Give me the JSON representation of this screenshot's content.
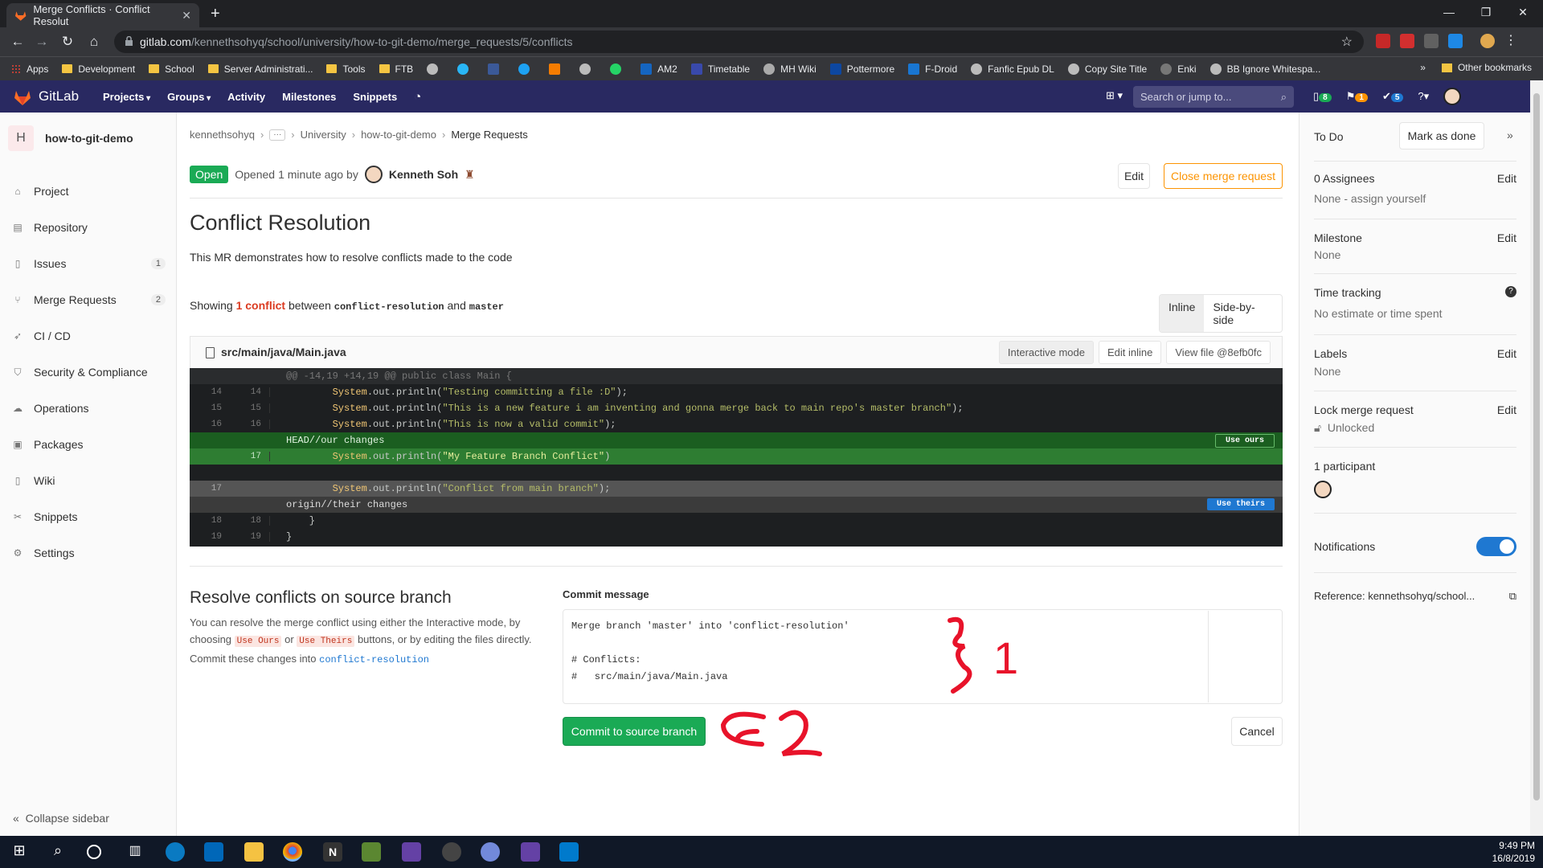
{
  "browser": {
    "tab_title": "Merge Conflicts · Conflict Resolut",
    "url_host": "gitlab.com",
    "url_path": "/kennethsohyq/school/university/how-to-git-demo/merge_requests/5/conflicts",
    "bookmarks": [
      "Apps",
      "Development",
      "School",
      "Server Administrati...",
      "Tools",
      "FTB",
      "",
      "",
      "",
      "",
      "",
      "",
      "",
      "AM2",
      "Timetable",
      "MH Wiki",
      "Pottermore",
      "F-Droid",
      "Fanfic Epub DL",
      "Copy Site Title",
      "Enki",
      "BB Ignore Whitespa..."
    ],
    "other_bookmarks": "Other bookmarks"
  },
  "gitlab": {
    "brand": "GitLab",
    "nav": [
      "Projects",
      "Groups",
      "Activity",
      "Milestones",
      "Snippets"
    ],
    "search_placeholder": "Search or jump to...",
    "badge_mr": "8",
    "badge_issues": "1",
    "badge_todos": "5"
  },
  "sidebar": {
    "project_initial": "H",
    "project_name": "how-to-git-demo",
    "items": [
      {
        "label": "Project",
        "icon": "home-icon",
        "count": ""
      },
      {
        "label": "Repository",
        "icon": "book-icon",
        "count": ""
      },
      {
        "label": "Issues",
        "icon": "issues-icon",
        "count": "1"
      },
      {
        "label": "Merge Requests",
        "icon": "merge-request-icon",
        "count": "2"
      },
      {
        "label": "CI / CD",
        "icon": "rocket-icon",
        "count": ""
      },
      {
        "label": "Security & Compliance",
        "icon": "shield-icon",
        "count": ""
      },
      {
        "label": "Operations",
        "icon": "cloud-icon",
        "count": ""
      },
      {
        "label": "Packages",
        "icon": "package-icon",
        "count": ""
      },
      {
        "label": "Wiki",
        "icon": "book-icon",
        "count": ""
      },
      {
        "label": "Snippets",
        "icon": "scissors-icon",
        "count": ""
      },
      {
        "label": "Settings",
        "icon": "gear-icon",
        "count": ""
      }
    ],
    "collapse": "Collapse sidebar"
  },
  "breadcrumb": {
    "items": [
      "kennethsohyq",
      "University",
      "how-to-git-demo",
      "Merge Requests"
    ]
  },
  "mr": {
    "status": "Open",
    "opened_text": "Opened",
    "opened_time": "1 minute ago",
    "by": "by",
    "author": "Kenneth Soh",
    "edit": "Edit",
    "close": "Close merge request",
    "title": "Conflict Resolution",
    "description": "This MR demonstrates how to resolve conflicts made to the code",
    "showing_pre": "Showing",
    "conflict_count": "1 conflict",
    "between": "between",
    "source_branch": "conflict-resolution",
    "and": "and",
    "target_branch": "master",
    "view_inline": "Inline",
    "view_side": "Side-by-side"
  },
  "file": {
    "path": "src/main/java/Main.java",
    "btn_interactive": "Interactive mode",
    "btn_edit_inline": "Edit inline",
    "btn_view_file": "View file @8efb0fc",
    "hunk": "@@ -14,19 +14,19 @@ public class Main {",
    "lines": [
      {
        "old": "14",
        "new": "14",
        "pre": "        ",
        "obj": "System",
        "mid": ".out.println(",
        "str": "\"Testing committing a file :D\"",
        "post": ");"
      },
      {
        "old": "15",
        "new": "15",
        "pre": "        ",
        "obj": "System",
        "mid": ".out.println(",
        "str": "\"This is a new feature i am inventing and gonna merge back to main repo's master branch\"",
        "post": ");"
      },
      {
        "old": "16",
        "new": "16",
        "pre": "        ",
        "obj": "System",
        "mid": ".out.println(",
        "str": "\"This is now a valid commit\"",
        "post": ");"
      }
    ],
    "ours_header": "HEAD//our changes",
    "use_ours": "Use ours",
    "ours_line": {
      "new": "17",
      "pre": "        ",
      "obj": "System",
      "mid": ".out.println(",
      "str": "\"My Feature Branch Conflict\"",
      "post": ")"
    },
    "theirs_line": {
      "old": "17",
      "pre": "        ",
      "obj": "System",
      "mid": ".out.println(",
      "str": "\"Conflict from main branch\"",
      "post": ");"
    },
    "theirs_header": "origin//their changes",
    "use_theirs": "Use theirs",
    "tail": [
      {
        "old": "18",
        "new": "18",
        "text": "    }"
      },
      {
        "old": "19",
        "new": "19",
        "text": "}"
      }
    ]
  },
  "resolve": {
    "title": "Resolve conflicts on source branch",
    "desc_1": "You can resolve the merge conflict using either the Interactive mode, by choosing",
    "use_ours_code": "Use Ours",
    "or": "or",
    "use_theirs_code": "Use Theirs",
    "desc_2": "buttons, or by editing the files directly. Commit these changes into",
    "branch": "conflict-resolution",
    "commit_label": "Commit message",
    "commit_message": "Merge branch 'master' into 'conflict-resolution'\n\n# Conflicts:\n#   src/main/java/Main.java",
    "commit_button": "Commit to source branch",
    "cancel": "Cancel"
  },
  "right_sidebar": {
    "todo": "To Do",
    "mark_done": "Mark as done",
    "assignees_title": "0 Assignees",
    "assignees_val": "None - assign yourself",
    "milestone_title": "Milestone",
    "milestone_val": "None",
    "time_title": "Time tracking",
    "time_val": "No estimate or time spent",
    "labels_title": "Labels",
    "labels_val": "None",
    "lock_title": "Lock merge request",
    "lock_val": "Unlocked",
    "participants": "1 participant",
    "notifications": "Notifications",
    "reference": "Reference: kennethsohyq/school...",
    "edit": "Edit"
  },
  "annotations": {
    "mark_1": "1",
    "mark_2": "2"
  },
  "taskbar": {
    "time": "9:49 PM",
    "date": "16/8/2019"
  },
  "colors": {
    "gitlab_nav": "#292961",
    "open_badge": "#1aaa55",
    "ours": "#2e7d32",
    "annotation": "#e8132a"
  }
}
